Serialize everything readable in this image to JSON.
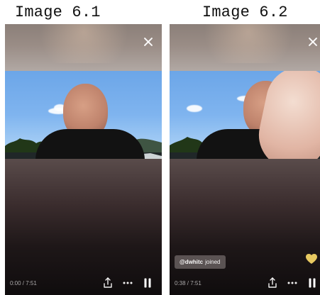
{
  "captions": {
    "left": "Image 6.1",
    "right": "Image 6.2"
  },
  "left_screen": {
    "timestamp": "0:00 / 7:51",
    "icons": [
      "close-icon",
      "share-icon",
      "more-icon",
      "pause-icon"
    ]
  },
  "right_screen": {
    "timestamp": "0:38 / 7:51",
    "join_user": "@dwhitc",
    "join_text": "joined",
    "icons": [
      "close-icon",
      "share-icon",
      "more-icon",
      "pause-icon",
      "heart-icon"
    ]
  },
  "colors": {
    "heart": "#e7c961"
  }
}
